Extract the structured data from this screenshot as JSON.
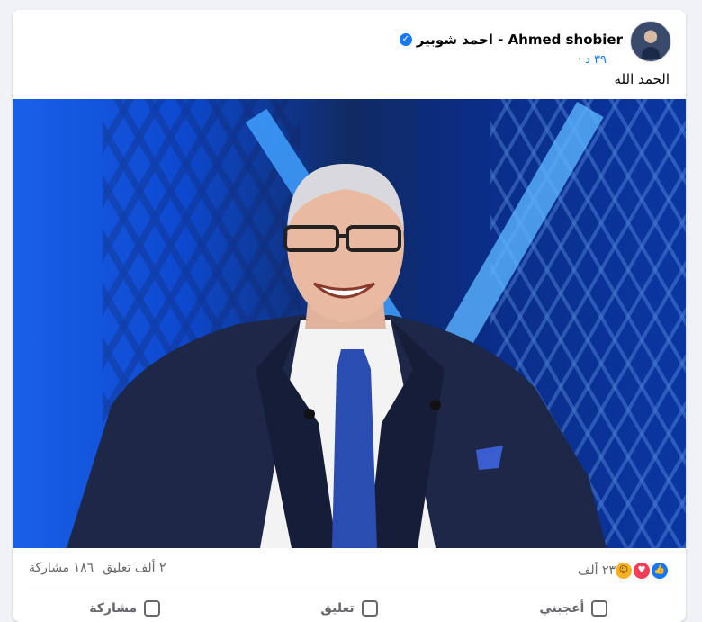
{
  "post": {
    "author": "Ahmed shobier - احمد شوبير",
    "time": "٣٩ د ·",
    "caption": "الحمد الله"
  },
  "stats": {
    "reactions_count": "٢٣ ألف",
    "comments": "٢ ألف تعليق",
    "shares": "١٨٦ مشاركة"
  },
  "actions": {
    "like": "أعجبني",
    "comment": "تعليق",
    "share": "مشاركة"
  },
  "colors": {
    "accent": "#1877f2",
    "love": "#f33e58",
    "haha": "#f7b125"
  },
  "icons": [
    "verified-badge-icon",
    "like-reaction-icon",
    "love-reaction-icon",
    "haha-reaction-icon",
    "like-icon",
    "comment-icon",
    "share-icon"
  ]
}
